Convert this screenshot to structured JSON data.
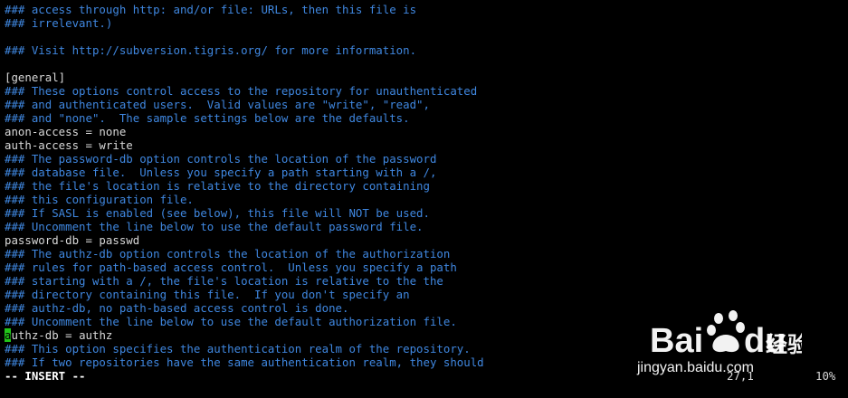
{
  "editor": {
    "lines": [
      {
        "type": "comment",
        "text": "### access through http: and/or file: URLs, then this file is"
      },
      {
        "type": "comment",
        "text": "### irrelevant.)"
      },
      {
        "type": "blank",
        "text": ""
      },
      {
        "type": "comment",
        "text": "### Visit http://subversion.tigris.org/ for more information."
      },
      {
        "type": "blank",
        "text": ""
      },
      {
        "type": "plain",
        "text": "[general]"
      },
      {
        "type": "comment",
        "text": "### These options control access to the repository for unauthenticated"
      },
      {
        "type": "comment",
        "text": "### and authenticated users.  Valid values are \"write\", \"read\","
      },
      {
        "type": "comment",
        "text": "### and \"none\".  The sample settings below are the defaults."
      },
      {
        "type": "plain",
        "text": "anon-access = none"
      },
      {
        "type": "plain",
        "text": "auth-access = write"
      },
      {
        "type": "comment",
        "text": "### The password-db option controls the location of the password"
      },
      {
        "type": "comment",
        "text": "### database file.  Unless you specify a path starting with a /,"
      },
      {
        "type": "comment",
        "text": "### the file's location is relative to the directory containing"
      },
      {
        "type": "comment",
        "text": "### this configuration file."
      },
      {
        "type": "comment",
        "text": "### If SASL is enabled (see below), this file will NOT be used."
      },
      {
        "type": "comment",
        "text": "### Uncomment the line below to use the default password file."
      },
      {
        "type": "plain",
        "text": "password-db = passwd"
      },
      {
        "type": "comment",
        "text": "### The authz-db option controls the location of the authorization"
      },
      {
        "type": "comment",
        "text": "### rules for path-based access control.  Unless you specify a path"
      },
      {
        "type": "comment",
        "text": "### starting with a /, the file's location is relative to the the"
      },
      {
        "type": "comment",
        "text": "### directory containing this file.  If you don't specify an"
      },
      {
        "type": "comment",
        "text": "### authz-db, no path-based access control is done."
      },
      {
        "type": "comment",
        "text": "### Uncomment the line below to use the default authorization file."
      },
      {
        "type": "cursor",
        "cursor_char": "a",
        "text": "uthz-db = authz"
      },
      {
        "type": "comment",
        "text": "### This option specifies the authentication realm of the repository."
      },
      {
        "type": "comment",
        "text": "### If two repositories have the same authentication realm, they should"
      }
    ]
  },
  "status": {
    "mode": "-- INSERT --",
    "position": "27,1",
    "percent": "10%"
  },
  "watermark": {
    "brand_text": "jingyan.baidu.com",
    "logo_text": "Bai du 经验"
  },
  "colors": {
    "background": "#000000",
    "comment": "#3f87e0",
    "plain": "#d8d8d8",
    "cursor": "#22c41a"
  }
}
